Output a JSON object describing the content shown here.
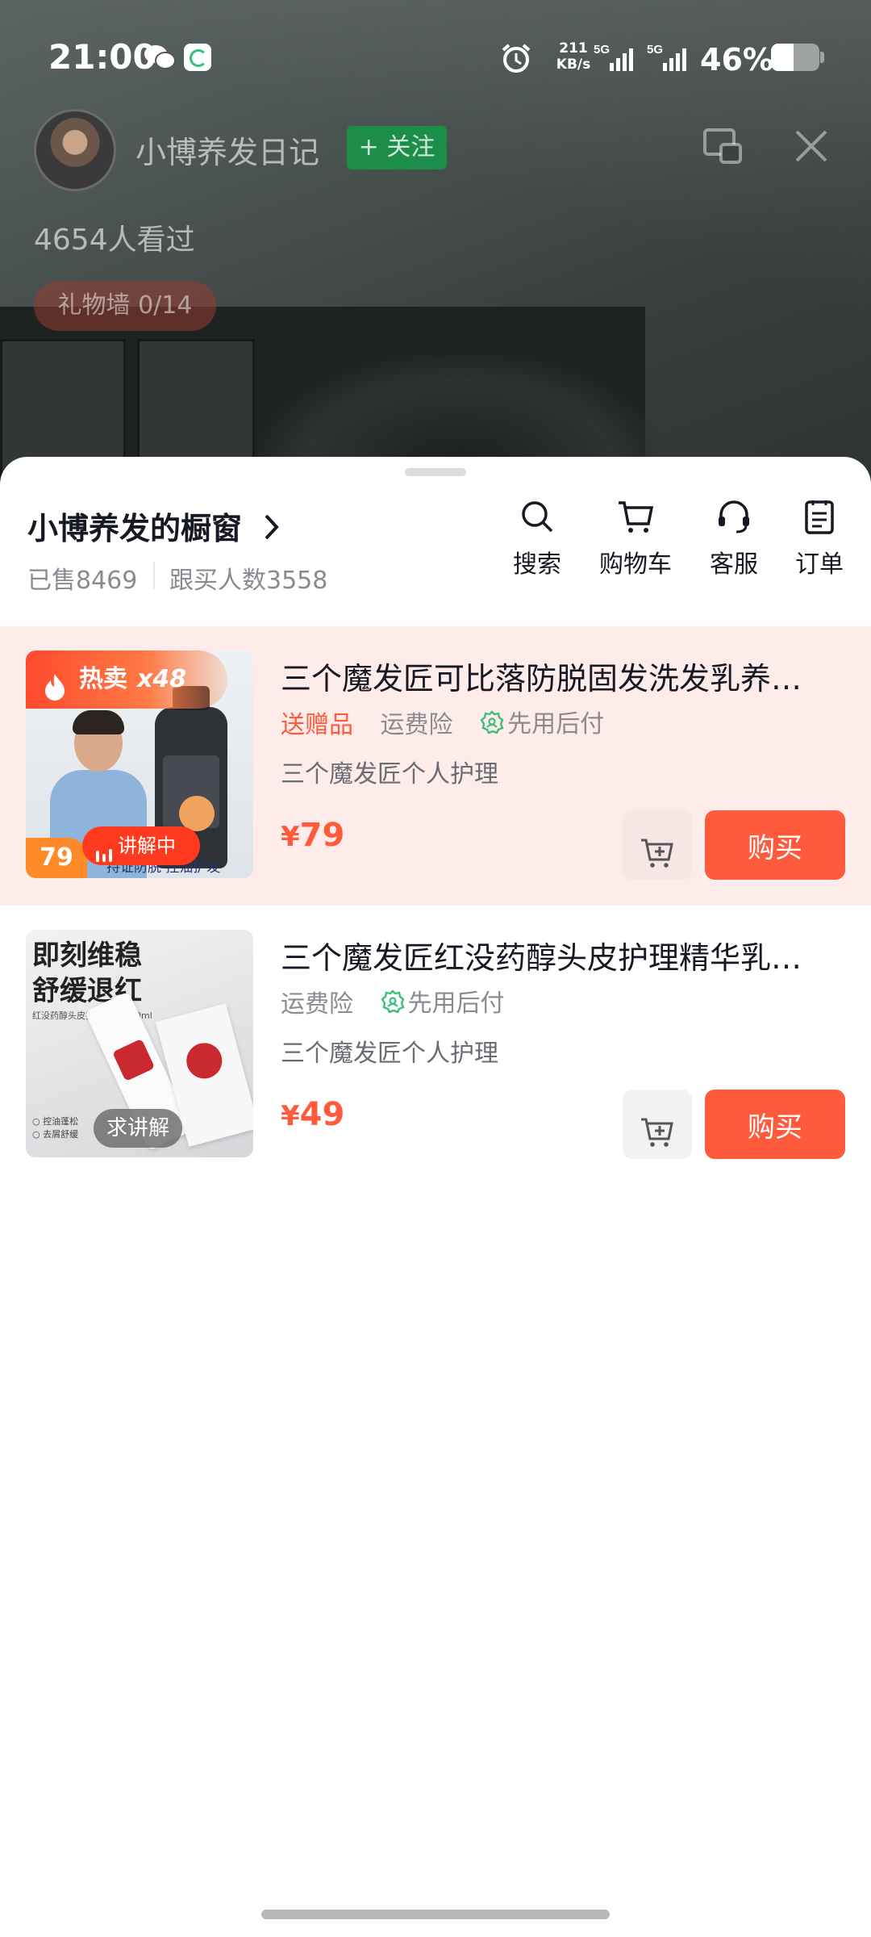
{
  "status_bar": {
    "time": "21:00",
    "net_speed_value": "211",
    "net_speed_unit": "KB/s",
    "sim1": "5G",
    "sim2": "5G",
    "battery_percent_text": "46%",
    "battery_level": 0.46,
    "icons": [
      "wechat-icon",
      "app-icon",
      "alarm-icon",
      "signal-icon",
      "battery-icon"
    ]
  },
  "live": {
    "streamer_name": "小博养发日记",
    "follow_label": "+ 关注",
    "viewers": "4654人看过",
    "gift_wall": "礼物墙 0/14",
    "icons": [
      "pip-icon",
      "close-icon"
    ]
  },
  "shop": {
    "title": "小博养发的橱窗",
    "sold": "已售8469",
    "followers": "跟买人数3558",
    "tools": [
      {
        "label": "搜索",
        "icon": "search-icon"
      },
      {
        "label": "购物车",
        "icon": "cart-icon"
      },
      {
        "label": "客服",
        "icon": "headset-icon"
      },
      {
        "label": "订单",
        "icon": "order-icon"
      }
    ]
  },
  "products": [
    {
      "title": "三个魔发匠可比落防脱固发洗发乳养…",
      "tags": [
        "送赠品",
        "运费险",
        "先用后付"
      ],
      "shop": "三个魔发匠个人护理",
      "currency": "¥",
      "price": "79",
      "hot_label": "热卖",
      "hot_count": "x48",
      "thumb_price": "79",
      "status_label": "讲解中",
      "thumb_caption": "持证防脱 控油护发",
      "buy_label": "购买",
      "active": true
    },
    {
      "title": "三个魔发匠红没药醇头皮护理精华乳…",
      "tags": [
        "运费险",
        "先用后付"
      ],
      "shop": "三个魔发匠个人护理",
      "currency": "¥",
      "price": "49",
      "thumb_headline_1": "即刻维稳",
      "thumb_headline_2": "舒缓退红",
      "thumb_sub": "红没药醇头皮护理精华乳60ml",
      "thumb_bullet_1": "○ 控油蓬松",
      "thumb_bullet_2": "○ 去屑舒缓",
      "status_label": "求讲解",
      "buy_label": "购买",
      "active": false
    }
  ],
  "colors": {
    "accent": "#fe5a3b",
    "active_card_bg": "#fdecea",
    "follow_green": "#1d8d4a",
    "text_primary": "#161823",
    "text_secondary": "#8a8b91"
  }
}
